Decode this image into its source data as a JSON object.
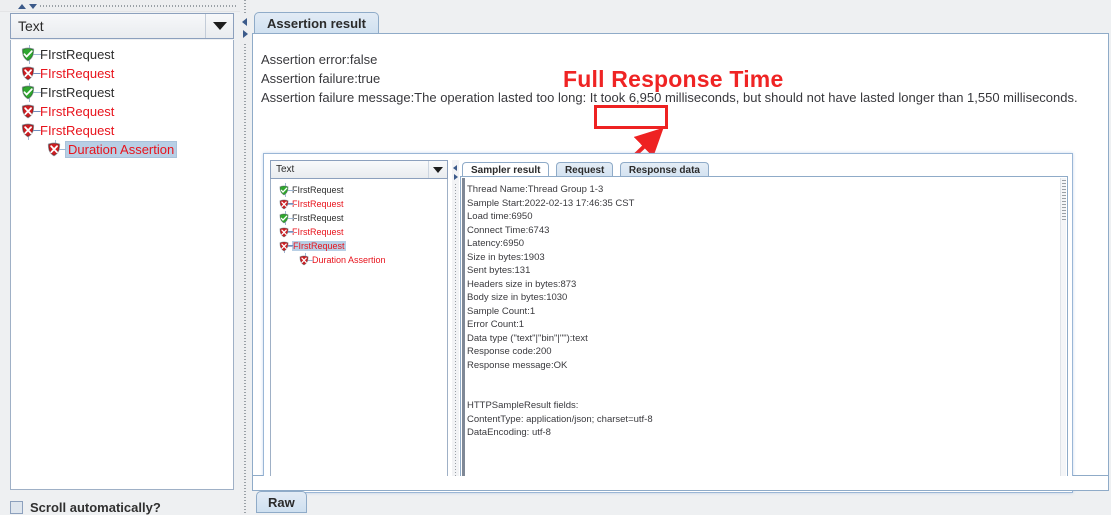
{
  "left_panel": {
    "combo": {
      "value": "Text",
      "icon": "chevron-down-icon"
    },
    "tree": [
      {
        "label": "FIrstRequest",
        "status": "pass",
        "depth": 1,
        "expander": "none",
        "selected": false
      },
      {
        "label": "FIrstRequest",
        "status": "fail",
        "depth": 1,
        "expander": "collapsed",
        "selected": false
      },
      {
        "label": "FIrstRequest",
        "status": "pass",
        "depth": 1,
        "expander": "none",
        "selected": false
      },
      {
        "label": "FIrstRequest",
        "status": "fail",
        "depth": 1,
        "expander": "collapsed",
        "selected": false
      },
      {
        "label": "FIrstRequest",
        "status": "fail",
        "depth": 1,
        "expander": "expanded",
        "selected": false
      },
      {
        "label": "Duration Assertion",
        "status": "fail",
        "depth": 2,
        "expander": "none",
        "selected": true
      }
    ],
    "scroll_checkbox": {
      "label": "Scroll automatically?",
      "checked": false
    }
  },
  "splitters": {
    "top_up_icon": "triangle-up-icon",
    "top_down_icon": "triangle-down-icon",
    "left_icon": "triangle-left-icon",
    "right_icon": "triangle-right-icon"
  },
  "right_panel": {
    "tabs": [
      {
        "label": "Assertion result",
        "active": true
      }
    ],
    "assertion_lines": [
      "Assertion error:false",
      "Assertion failure:true",
      "Assertion failure message:The operation lasted too long: It took 6,950 milliseconds, but should not have lasted longer than 1,550 milliseconds."
    ],
    "bottom_tabs": [
      {
        "label": "Raw",
        "active": true
      }
    ]
  },
  "annotation": {
    "title": "Full Response Time",
    "title_color": "#ef2424",
    "box_color": "#ee2222",
    "highlight_1": "6,950 mill",
    "highlight_2": "Latency:6950"
  },
  "inner_panel": {
    "combo": {
      "value": "Text",
      "icon": "chevron-down-icon"
    },
    "tree": [
      {
        "label": "FIrstRequest",
        "status": "pass",
        "depth": 1,
        "expander": "none",
        "selected": false
      },
      {
        "label": "FIrstRequest",
        "status": "fail",
        "depth": 1,
        "expander": "collapsed",
        "selected": false
      },
      {
        "label": "FIrstRequest",
        "status": "pass",
        "depth": 1,
        "expander": "none",
        "selected": false
      },
      {
        "label": "FIrstRequest",
        "status": "fail",
        "depth": 1,
        "expander": "collapsed",
        "selected": false
      },
      {
        "label": "FIrstRequest",
        "status": "fail",
        "depth": 1,
        "expander": "expanded",
        "selected": true
      },
      {
        "label": "Duration Assertion",
        "status": "fail",
        "depth": 2,
        "expander": "none",
        "selected": false
      }
    ],
    "tabs": [
      {
        "label": "Sampler result",
        "active": true
      },
      {
        "label": "Request",
        "active": false
      },
      {
        "label": "Response data",
        "active": false
      }
    ],
    "sampler_result": [
      "Thread Name:Thread Group 1-3",
      "Sample Start:2022-02-13 17:46:35 CST",
      "Load time:6950",
      "Connect Time:6743",
      "Latency:6950",
      "Size in bytes:1903",
      "Sent bytes:131",
      "Headers size in bytes:873",
      "Body size in bytes:1030",
      "Sample Count:1",
      "Error Count:1",
      "Data type (\"text\"|\"bin\"|\"\"):text",
      "Response code:200",
      "Response message:OK",
      "",
      "",
      "HTTPSampleResult fields:",
      "ContentType: application/json; charset=utf-8",
      "DataEncoding: utf-8"
    ]
  }
}
